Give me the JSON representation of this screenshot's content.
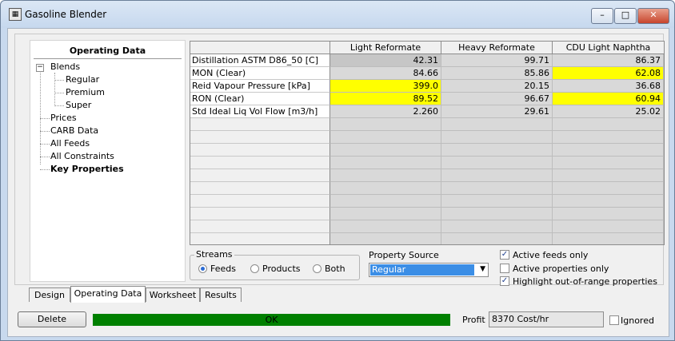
{
  "window": {
    "title": "Gasoline Blender",
    "icon": "app-grid-icon"
  },
  "window_controls": {
    "minimize": "–",
    "maximize": "□",
    "close": "✕"
  },
  "nav": {
    "header": "Operating Data",
    "items": [
      {
        "label": "Blends",
        "expander": "−"
      },
      {
        "label": "Regular"
      },
      {
        "label": "Premium"
      },
      {
        "label": "Super"
      },
      {
        "label": "Prices"
      },
      {
        "label": "CARB Data"
      },
      {
        "label": "All Feeds"
      },
      {
        "label": "All Constraints"
      },
      {
        "label": "Key Properties"
      }
    ]
  },
  "grid": {
    "columns": [
      "Light Reformate",
      "Heavy Reformate",
      "CDU Light Naphtha"
    ],
    "rows": [
      {
        "label": "Distillation ASTM D86_50 [C]",
        "values": [
          "42.31",
          "99.71",
          "86.37"
        ]
      },
      {
        "label": "MON (Clear)",
        "values": [
          "84.66",
          "85.86",
          "62.08"
        ]
      },
      {
        "label": "Reid Vapour Pressure [kPa]",
        "values": [
          "399.0",
          "20.15",
          "36.68"
        ]
      },
      {
        "label": "RON (Clear)",
        "values": [
          "89.52",
          "96.67",
          "60.94"
        ]
      },
      {
        "label": "Std Ideal Liq Vol Flow [m3/h]",
        "values": [
          "2.260",
          "29.61",
          "25.02"
        ]
      }
    ],
    "highlight_color": "#ffff00"
  },
  "streams": {
    "title": "Streams",
    "options": [
      "Feeds",
      "Products",
      "Both"
    ],
    "selected": "Feeds"
  },
  "property_source": {
    "label": "Property Source",
    "value": "Regular"
  },
  "checkboxes": [
    {
      "label": "Active feeds only",
      "checked": true
    },
    {
      "label": "Active properties only",
      "checked": false
    },
    {
      "label": "Highlight out-of-range properties",
      "checked": true
    }
  ],
  "tabs": [
    "Design",
    "Operating Data",
    "Worksheet",
    "Results"
  ],
  "active_tab": "Operating Data",
  "bottom": {
    "delete_label": "Delete",
    "status_text": "OK",
    "status_color": "#008000",
    "profit_label": "Profit",
    "profit_value": "8370 Cost/hr",
    "ignored_label": "Ignored"
  }
}
